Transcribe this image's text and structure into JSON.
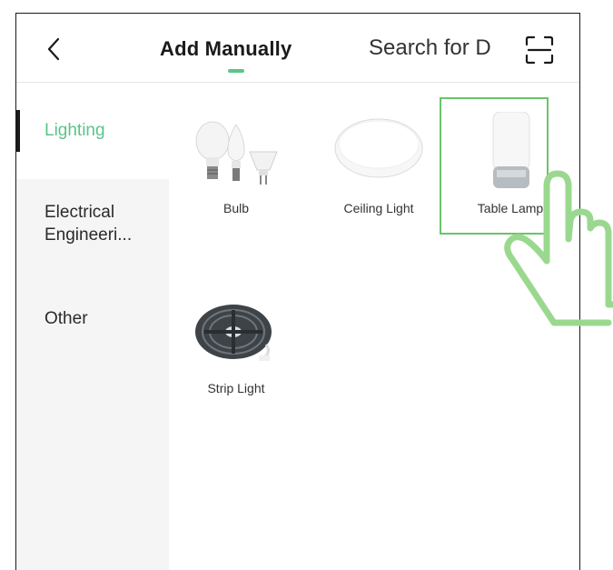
{
  "header": {
    "title": "Add Manually",
    "search_tab": "Search for D",
    "accent_color": "#5cc48a"
  },
  "sidebar": {
    "items": [
      {
        "label": "Lighting",
        "active": true
      },
      {
        "label": "Electrical Engineeri...",
        "active": false
      },
      {
        "label": "Other",
        "active": false
      }
    ]
  },
  "devices": [
    {
      "label": "Bulb",
      "icon": "bulb-icon"
    },
    {
      "label": "Ceiling Light",
      "icon": "ceiling-light-icon"
    },
    {
      "label": "Table Lamp",
      "icon": "table-lamp-icon"
    },
    {
      "label": "Strip Light",
      "icon": "strip-light-icon"
    }
  ],
  "highlight_color": "#6ac46a"
}
